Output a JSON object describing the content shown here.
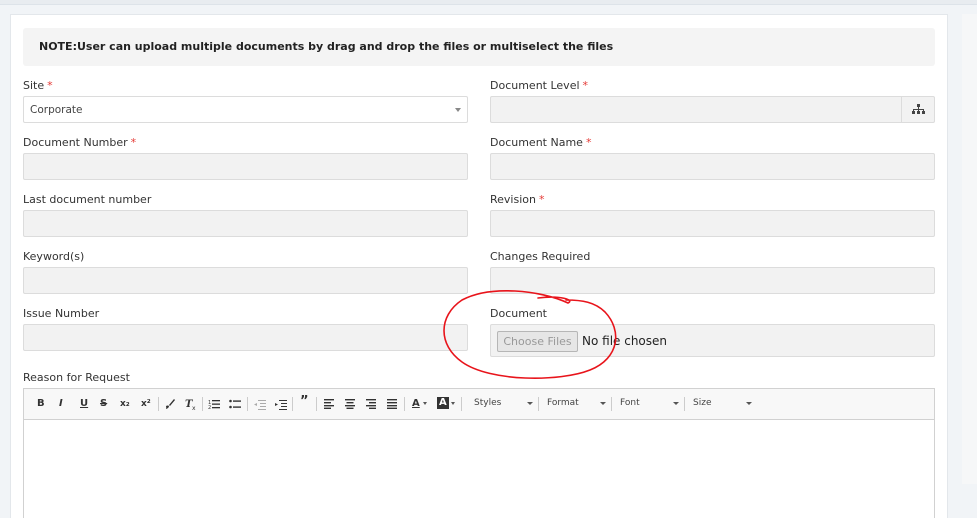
{
  "note": "NOTE:User can upload multiple documents by drag and drop the files or multiselect the files",
  "fields": {
    "site": {
      "label": "Site",
      "value": "Corporate"
    },
    "document_level": {
      "label": "Document Level"
    },
    "document_number": {
      "label": "Document Number"
    },
    "document_name": {
      "label": "Document Name"
    },
    "last_document_number": {
      "label": "Last document number"
    },
    "revision": {
      "label": "Revision"
    },
    "keywords": {
      "label": "Keyword(s)"
    },
    "changes_required": {
      "label": "Changes Required"
    },
    "issue_number": {
      "label": "Issue Number"
    },
    "document": {
      "label": "Document",
      "button": "Choose Files",
      "status": "No file chosen"
    },
    "reason": {
      "label": "Reason for Request"
    }
  },
  "required_mark": "*",
  "toolbar": {
    "bold": "B",
    "italic": "I",
    "underline": "U",
    "strike": "S",
    "subscript": "x₂",
    "superscript": "x²",
    "styles": "Styles",
    "format": "Format",
    "font": "Font",
    "size": "Size",
    "text_color": "A",
    "bg_color": "A"
  },
  "colors": {
    "required": "#e53935",
    "annotation": "#e8141b"
  }
}
